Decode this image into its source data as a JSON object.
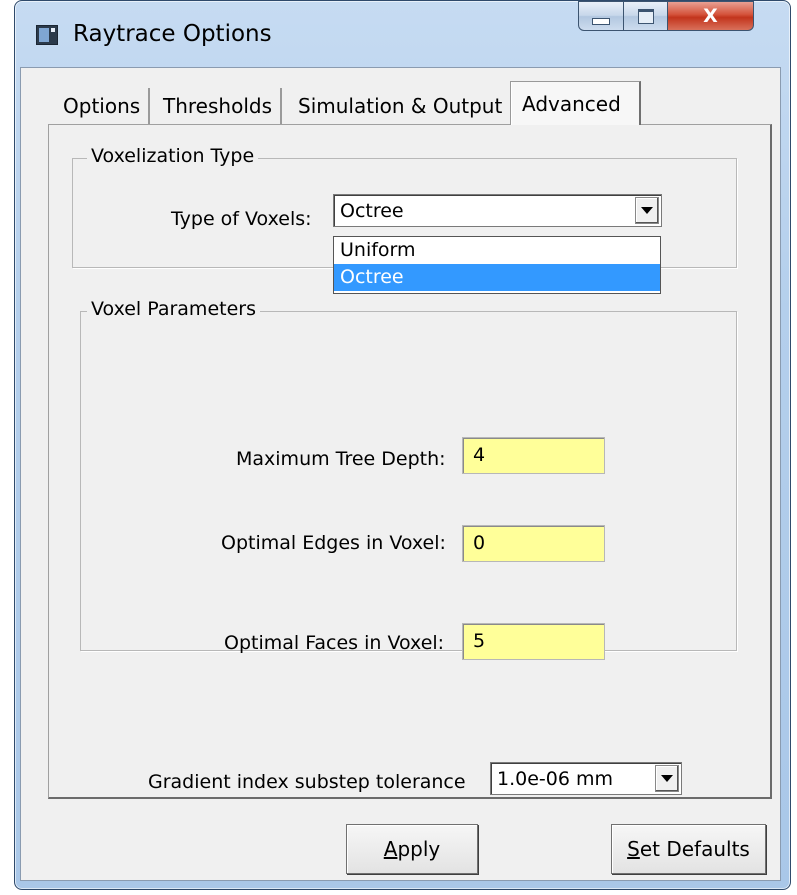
{
  "window": {
    "title": "Raytrace Options",
    "close_glyph": "X"
  },
  "tabs": [
    {
      "label": "Options"
    },
    {
      "label": "Thresholds"
    },
    {
      "label": "Simulation & Output"
    },
    {
      "label": "Advanced"
    }
  ],
  "voxelization": {
    "group_title": "Voxelization Type",
    "type_label": "Type of Voxels:",
    "selected": "Octree",
    "options": [
      "Uniform",
      "Octree"
    ]
  },
  "voxel_params": {
    "group_title": "Voxel Parameters",
    "max_depth_label": "Maximum Tree Depth:",
    "max_depth_value": "4",
    "edges_label": "Optimal Edges in Voxel:",
    "edges_value": "0",
    "faces_label": "Optimal Faces in Voxel:",
    "faces_value": "5"
  },
  "gradient": {
    "label": "Gradient index substep tolerance",
    "value": "1.0e-06 mm"
  },
  "buttons": {
    "apply_mnemonic": "A",
    "apply_rest": "pply",
    "defaults_mnemonic": "S",
    "defaults_rest": "et Defaults"
  },
  "colors": {
    "field_bg": "#ffff99",
    "selection": "#3399ff",
    "close_button": "#c2341c"
  },
  "icons": [
    "app-icon",
    "minimize-icon",
    "maximize-icon",
    "close-icon",
    "dropdown-arrow-icon"
  ]
}
